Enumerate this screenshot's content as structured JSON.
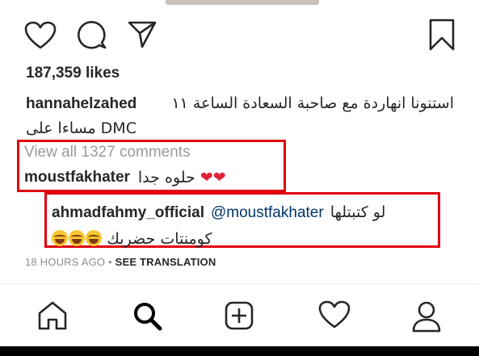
{
  "icons": {
    "like": "heart-outline-icon",
    "comment": "speech-bubble-icon",
    "share": "paper-plane-icon",
    "save": "bookmark-icon"
  },
  "post": {
    "likes": "187,359 likes",
    "caption": {
      "username": "hannahelzahed",
      "text_line1": "استنونا انهاردة مع صاحبة السعادة الساعة ١١",
      "text_line2": "DMC مساءا على"
    },
    "view_all_comments": "View all 1327 comments",
    "comments": [
      {
        "username": "moustfakhater",
        "text": "حلوه جدا",
        "emoji": "❤❤"
      }
    ],
    "reply": {
      "username": "ahmadfahmy_official",
      "mention": "@moustfakhater",
      "text_line1": "لو كتبتلها",
      "text_line2": "كومنتات حضربك"
    },
    "time_ago": "18 HOURS AGO",
    "separator": "•",
    "see_translation": "SEE TRANSLATION"
  },
  "tab_bar": {
    "items": [
      "home-icon",
      "search-icon",
      "new-post-icon",
      "activity-heart-icon",
      "profile-icon"
    ]
  },
  "colors": {
    "highlight_box": "#e0000f",
    "muted_text": "#8e8e8e",
    "mention": "#003569"
  }
}
